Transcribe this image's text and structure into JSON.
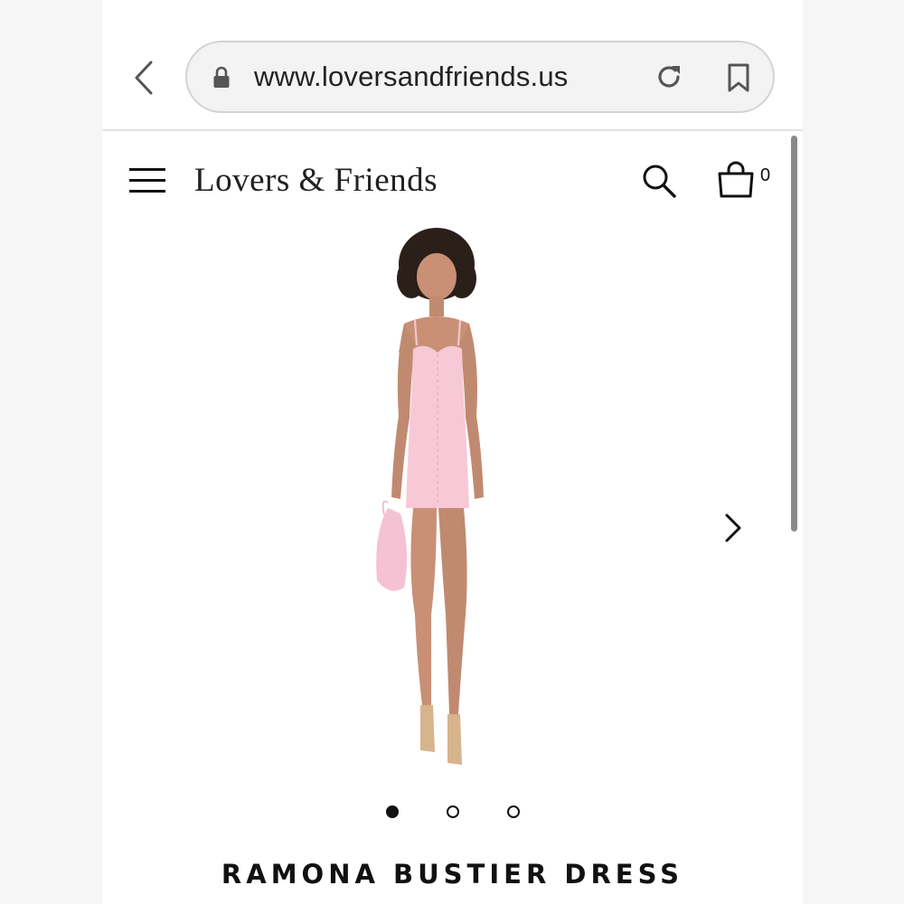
{
  "browser": {
    "url": "www.loversandfriends.us",
    "icons": [
      "back-icon",
      "lock-icon",
      "reload-icon",
      "bookmark-icon"
    ]
  },
  "header": {
    "logo": "Lovers & Friends",
    "cart_count": "0",
    "icons": [
      "menu-icon",
      "search-icon",
      "shopping-bag-icon"
    ]
  },
  "product": {
    "title": "RAMONA BUSTIER DRESS",
    "dress_color": "#f7c9d6",
    "carousel": {
      "total": 3,
      "active_index": 0
    }
  },
  "colors": {
    "accent": "#111111",
    "background": "#ffffff"
  }
}
